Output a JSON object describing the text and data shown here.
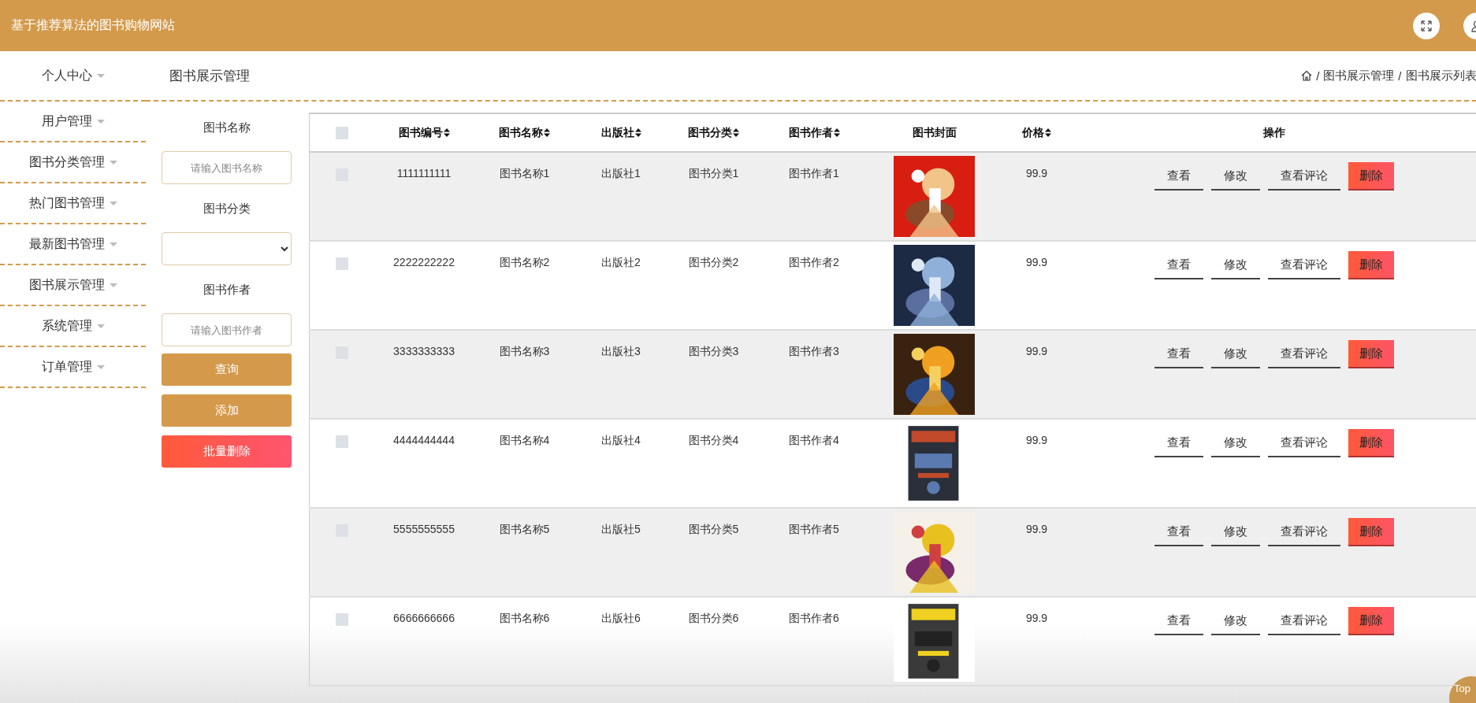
{
  "app": {
    "title": "基于推荐算法的图书购物网站"
  },
  "sidebar": {
    "items": [
      {
        "label": "个人中心"
      },
      {
        "label": "用户管理"
      },
      {
        "label": "图书分类管理"
      },
      {
        "label": "热门图书管理"
      },
      {
        "label": "最新图书管理"
      },
      {
        "label": "图书展示管理"
      },
      {
        "label": "系统管理"
      },
      {
        "label": "订单管理"
      }
    ]
  },
  "page_title": "图书展示管理",
  "breadcrumb": {
    "separator": "/",
    "items": [
      "图书展示管理",
      "图书展示列表"
    ]
  },
  "filters": [
    {
      "kind": "text",
      "label": "图书名称",
      "placeholder": "请输入图书名称"
    },
    {
      "kind": "select",
      "label": "图书分类"
    },
    {
      "kind": "text",
      "label": "图书作者",
      "placeholder": "请输入图书作者"
    }
  ],
  "filter_buttons": [
    {
      "kind": "primary",
      "label": "查询"
    },
    {
      "kind": "primary",
      "label": "添加"
    },
    {
      "kind": "danger",
      "label": "批量删除"
    }
  ],
  "table": {
    "all_checked": false,
    "columns": [
      {
        "label": "图书编号",
        "sortable": true
      },
      {
        "label": "图书名称",
        "sortable": true
      },
      {
        "label": "出版社",
        "sortable": true
      },
      {
        "label": "图书分类",
        "sortable": true
      },
      {
        "label": "图书作者",
        "sortable": true
      },
      {
        "label": "图书封面",
        "sortable": false
      },
      {
        "label": "价格",
        "sortable": true
      },
      {
        "label": "操作",
        "sortable": false
      }
    ],
    "rows": [
      {
        "checked": false,
        "cells": [
          "1111111111",
          "图书名称1",
          "出版社1",
          "图书分类1",
          "图书作者1"
        ],
        "cover": {
          "kind": "picture"
        },
        "price": "99.9",
        "actions": [
          {
            "kind": "link",
            "label": "查看"
          },
          {
            "kind": "link",
            "label": "修改"
          },
          {
            "kind": "link",
            "label": "查看评论"
          },
          {
            "kind": "danger",
            "label": "删除"
          }
        ]
      },
      {
        "checked": false,
        "cells": [
          "2222222222",
          "图书名称2",
          "出版社2",
          "图书分类2",
          "图书作者2"
        ],
        "cover": {
          "kind": "picture"
        },
        "price": "99.9",
        "actions": [
          {
            "kind": "link",
            "label": "查看"
          },
          {
            "kind": "link",
            "label": "修改"
          },
          {
            "kind": "link",
            "label": "查看评论"
          },
          {
            "kind": "danger",
            "label": "删除"
          }
        ]
      },
      {
        "checked": false,
        "cells": [
          "3333333333",
          "图书名称3",
          "出版社3",
          "图书分类3",
          "图书作者3"
        ],
        "cover": {
          "kind": "picture"
        },
        "price": "99.9",
        "actions": [
          {
            "kind": "link",
            "label": "查看"
          },
          {
            "kind": "link",
            "label": "修改"
          },
          {
            "kind": "link",
            "label": "查看评论"
          },
          {
            "kind": "danger",
            "label": "删除"
          }
        ]
      },
      {
        "checked": false,
        "cells": [
          "4444444444",
          "图书名称4",
          "出版社4",
          "图书分类4",
          "图书作者4"
        ],
        "cover": {
          "kind": "picture"
        },
        "price": "99.9",
        "actions": [
          {
            "kind": "link",
            "label": "查看"
          },
          {
            "kind": "link",
            "label": "修改"
          },
          {
            "kind": "link",
            "label": "查看评论"
          },
          {
            "kind": "danger",
            "label": "删除"
          }
        ]
      },
      {
        "checked": false,
        "cells": [
          "5555555555",
          "图书名称5",
          "出版社5",
          "图书分类5",
          "图书作者5"
        ],
        "cover": {
          "kind": "picture"
        },
        "price": "99.9",
        "actions": [
          {
            "kind": "link",
            "label": "查看"
          },
          {
            "kind": "link",
            "label": "修改"
          },
          {
            "kind": "link",
            "label": "查看评论"
          },
          {
            "kind": "danger",
            "label": "删除"
          }
        ]
      },
      {
        "checked": false,
        "cells": [
          "6666666666",
          "图书名称6",
          "出版社6",
          "图书分类6",
          "图书作者6"
        ],
        "cover": {
          "kind": "picture"
        },
        "price": "99.9",
        "actions": [
          {
            "kind": "link",
            "label": "查看"
          },
          {
            "kind": "link",
            "label": "修改"
          },
          {
            "kind": "link",
            "label": "查看评论"
          },
          {
            "kind": "danger",
            "label": "删除"
          }
        ]
      }
    ]
  },
  "back_to_top": "Top"
}
